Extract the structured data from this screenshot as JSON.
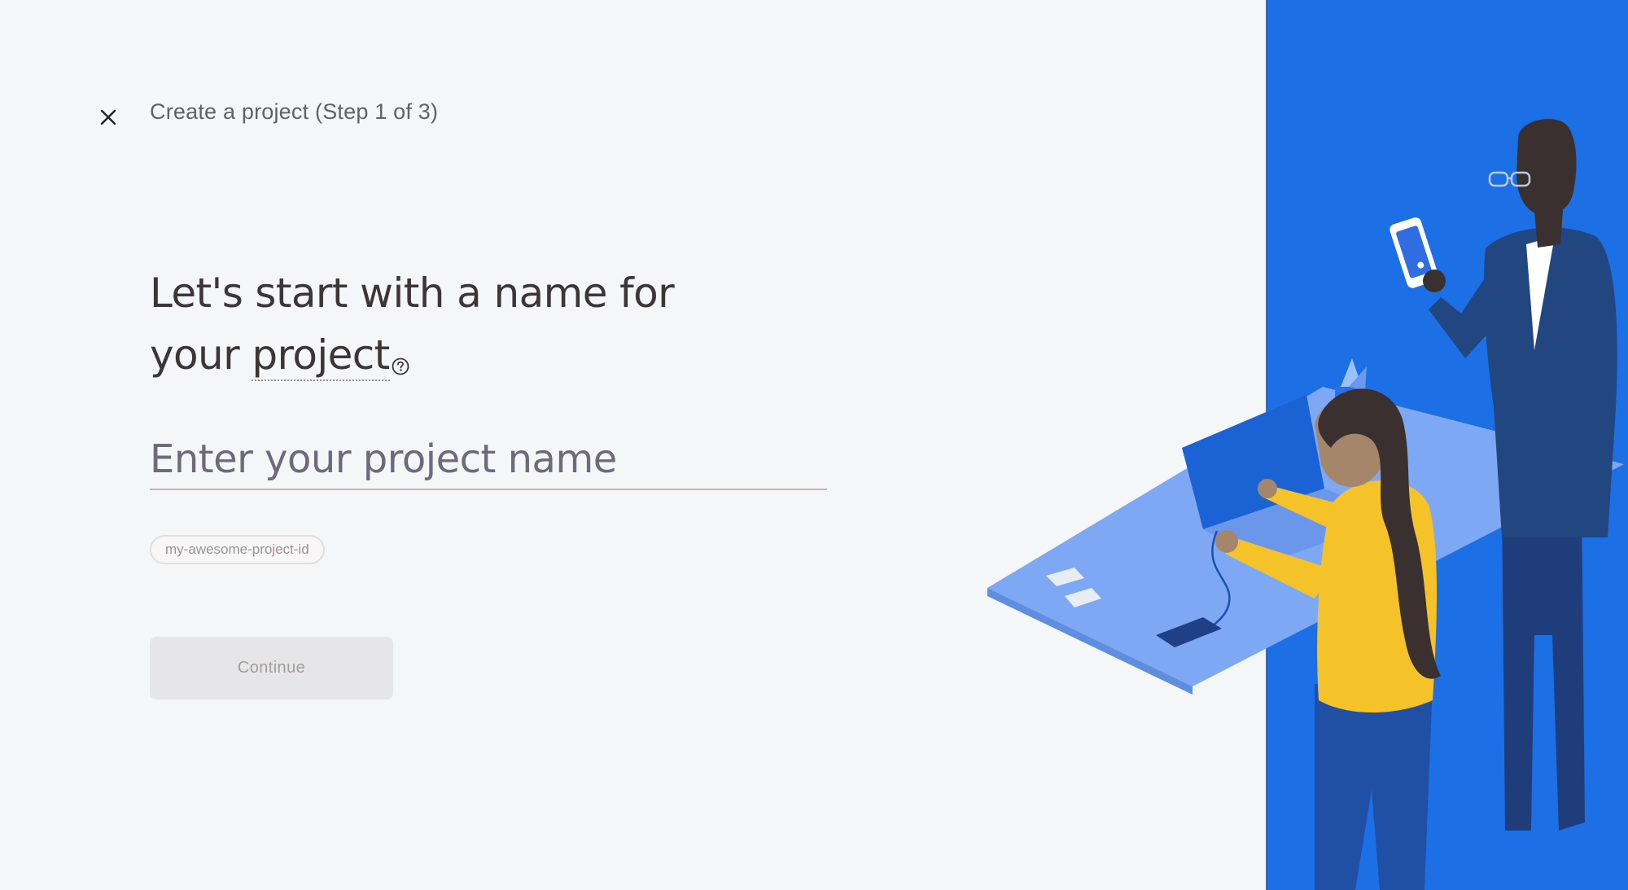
{
  "header": {
    "close_icon": "close-icon",
    "step_title": "Create a project (Step 1 of 3)"
  },
  "main": {
    "heading_line1": "Let's start with a name for",
    "heading_line2_prefix": "your ",
    "heading_term": "project",
    "help_icon": "help-circle-icon",
    "project_name_placeholder": "Enter your project name",
    "project_name_value": "",
    "project_id": "my-awesome-project-id",
    "continue_label": "Continue"
  },
  "hero": {
    "illustration": "people-at-desk-illustration"
  },
  "colors": {
    "accent_blue": "#1c6fe5",
    "background": "#f5f6f8",
    "heading_text": "#3c3636",
    "disabled_button": "#e6e6e9"
  }
}
